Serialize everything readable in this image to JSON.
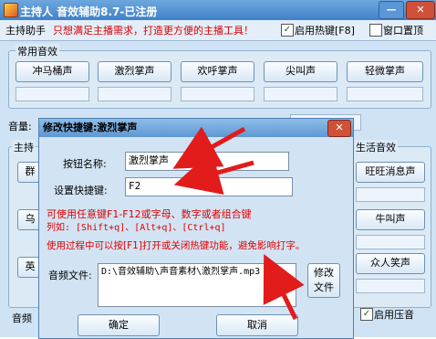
{
  "window": {
    "title": "主持人  音效辅助8.7-已注册",
    "minimize": "—",
    "close": "✕"
  },
  "topbar": {
    "tab": "主持助手",
    "slogan": "只想满足主播需求，打造更方便的主播工具！",
    "hotkey_label": "启用热键[F8]",
    "hotkey_checked": "✓",
    "ontop_label": "窗口置顶"
  },
  "common_sounds": {
    "title": "常用音效",
    "buttons": [
      "冲马桶声",
      "激烈掌声",
      "欢呼掌声",
      "尖叫声",
      "轻微掌声"
    ]
  },
  "volume_label": "音量:",
  "left_tab": "主持",
  "left_partial_buttons": [
    "群",
    "乌",
    "英"
  ],
  "life_sounds": {
    "title": "生活音效",
    "buttons": [
      "旺旺消息声",
      "牛叫声",
      "众人笑声"
    ]
  },
  "bottom": {
    "partial_label": "音频",
    "compress_label": "启用压音",
    "compress_checked": "✓"
  },
  "dialog": {
    "title": "修改快捷键:激烈掌声",
    "close": "✕",
    "name_label": "按钮名称:",
    "name_value": "激烈掌声",
    "hotkey_label": "设置快捷键:",
    "hotkey_value": "F2",
    "hint1": "可使用任意键F1-F12或字母、数字或者组合键",
    "hint2": "列如: [Shift+q]、[Alt+q]、[Ctrl+q]",
    "hint3": "使用过程中可以按[F1]打开或关闭热键功能，避免影响打字。",
    "file_label": "音频文件:",
    "file_value": "D:\\音效辅助\\声音素材\\激烈掌声.mp3",
    "edit_file_button": "修改\n文件",
    "ok_button": "确定",
    "cancel_button": "取消"
  },
  "colors": {
    "accent_red": "#e00000",
    "title_blue": "#3f82c9"
  }
}
